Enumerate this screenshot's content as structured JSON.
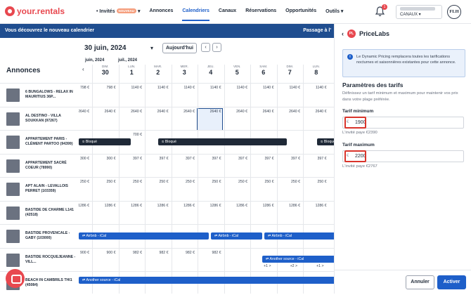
{
  "brand": {
    "name": "your.rentals",
    "color": "#e8484f"
  },
  "nav": {
    "items": [
      "Invités",
      "Annonces",
      "Calendriers",
      "Canaux",
      "Réservations",
      "Opportunités",
      "Outils"
    ],
    "invites_badge": "NOUVEAU",
    "active": "Calendriers"
  },
  "notifications": {
    "count": "1"
  },
  "account": {
    "label": "CANAUX",
    "initials": "FLH"
  },
  "banner": {
    "text": "Vous découvrez le nouveau calendrier",
    "right": "Passage à l'"
  },
  "toolbar": {
    "date": "30 juin, 2024",
    "today": "Aujourd'hui",
    "prev": "‹",
    "next": "›"
  },
  "listings_title": "Annonces",
  "calendar": {
    "months": [
      "juin, 2024",
      "juil., 2024"
    ],
    "days": [
      {
        "name": "DIM.",
        "num": "30"
      },
      {
        "name": "LUN.",
        "num": "1"
      },
      {
        "name": "MAR.",
        "num": "2"
      },
      {
        "name": "MER.",
        "num": "3"
      },
      {
        "name": "JEU.",
        "num": "4"
      },
      {
        "name": "VEN.",
        "num": "5"
      },
      {
        "name": "SAM.",
        "num": "6"
      },
      {
        "name": "DIM.",
        "num": "7"
      },
      {
        "name": "LUN.",
        "num": "8"
      }
    ],
    "listings": [
      {
        "name": "6 BUNGALOWS - RELAX IN MAURITIUS 36P...",
        "prices": [
          "798 €",
          "798 €",
          "1140 €",
          "1140 €",
          "1140 €",
          "1140 €",
          "1140 €",
          "1140 €",
          "1140 €",
          "1140 €"
        ]
      },
      {
        "name": "AL DESTINO - VILLA SOUKKAN (97267)",
        "prices": [
          "2640 €",
          "2640 €",
          "2640 €",
          "2640 €",
          "2640 €",
          "2640 €",
          "2640 €",
          "2640 €",
          "2640 €",
          "2640 €"
        ]
      },
      {
        "name": "Appartement Paris - Clément Partoo (94399)",
        "prices": [
          "",
          "",
          "700 €",
          "",
          "",
          "",
          "",
          "",
          "",
          ""
        ]
      },
      {
        "name": "APPARTEMENT SACRÉ COEUR (78990)",
        "prices": [
          "300 €",
          "300 €",
          "397 €",
          "397 €",
          "397 €",
          "397 €",
          "397 €",
          "397 €",
          "397 €",
          "397 €"
        ]
      },
      {
        "name": "Apt Alain - Levallois Perret (103359)",
        "prices": [
          "250 €",
          "250 €",
          "250 €",
          "250 €",
          "250 €",
          "250 €",
          "250 €",
          "250 €",
          "250 €",
          "250 €"
        ]
      },
      {
        "name": "BASTIDE DE CHARME L141 (42518)",
        "prices": [
          "1286 €",
          "1286 €",
          "1286 €",
          "1286 €",
          "1286 €",
          "1286 €",
          "1286 €",
          "1286 €",
          "1286 €",
          "1286 €"
        ]
      },
      {
        "name": "BASTIDE PROVENCALE - GABY (103000)",
        "prices": [
          "",
          "",
          "",
          "",
          "",
          "",
          "",
          "",
          "",
          ""
        ]
      },
      {
        "name": "BASTIDE ROCQUEJEANNE - VILL...",
        "prices": [
          "900 €",
          "900 €",
          "982 €",
          "982 €",
          "982 €",
          "982 €",
          "",
          "",
          "",
          ""
        ]
      },
      {
        "name": "BEACH IN CAMBRILS THI1 (45084)",
        "prices": [
          "",
          "",
          "",
          "",
          "",
          "",
          "",
          "",
          "",
          ""
        ]
      }
    ],
    "blocked_label": "Bloqué",
    "airbnb_label": "Airbnb - iCal",
    "other_label": "Another source - iCal",
    "min_stay_marks": [
      "+1 >",
      "+2 >",
      "+1 >"
    ]
  },
  "panel": {
    "title": "PriceLabs",
    "info": "Le Dynamic Pricing remplacera toutes les tarifications nocturnes et saisonnières existantes pour cette annonce.",
    "section_title": "Paramètres des tarifs",
    "section_desc": "Définissez un tarif minimum et maximum pour maintenir vos prix dans votre plage préférée.",
    "min_label": "Tarif minimum",
    "min_value": "1900",
    "min_hint": "L'invité paye €2390",
    "max_label": "Tarif maximum",
    "max_value": "2200",
    "max_hint": "L'invité paye €2767",
    "currency": "€",
    "cancel": "Annuler",
    "activate": "Activer"
  }
}
